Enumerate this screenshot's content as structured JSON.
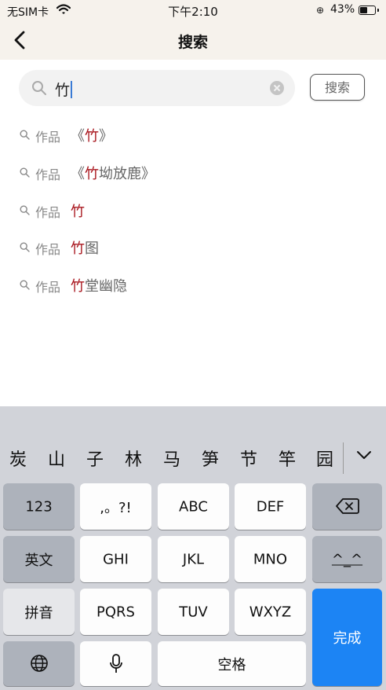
{
  "status_bar": {
    "carrier": "无SIM卡",
    "time": "下午2:10",
    "battery_percent": "43%",
    "battery_level": 0.43
  },
  "nav": {
    "title": "搜索"
  },
  "search": {
    "query": "竹",
    "button_label": "搜索"
  },
  "results": [
    {
      "category": "作品",
      "prefix": "《",
      "highlight": "竹",
      "suffix": "》"
    },
    {
      "category": "作品",
      "prefix": "《",
      "highlight": "竹",
      "suffix": "坳放鹿》"
    },
    {
      "category": "作品",
      "prefix": "",
      "highlight": "竹",
      "suffix": ""
    },
    {
      "category": "作品",
      "prefix": "",
      "highlight": "竹",
      "suffix": "图"
    },
    {
      "category": "作品",
      "prefix": "",
      "highlight": "竹",
      "suffix": "堂幽隐"
    }
  ],
  "keyboard": {
    "candidates": [
      "炭",
      "山",
      "子",
      "林",
      "马",
      "笋",
      "节",
      "竿",
      "园"
    ],
    "keys": {
      "num": "123",
      "punct": ",。?!",
      "abc": "ABC",
      "def": "DEF",
      "lang": "英文",
      "ghi": "GHI",
      "jkl": "JKL",
      "mno": "MNO",
      "emoticon": "^_^",
      "pinyin": "拼音",
      "pqrs": "PQRS",
      "tuv": "TUV",
      "wxyz": "WXYZ",
      "done": "完成",
      "space": "空格"
    }
  },
  "colors": {
    "highlight": "#a8141c",
    "done_key": "#1c84f4",
    "header_bg": "#f6f2ec"
  },
  "icons": [
    "wifi-icon",
    "lock-rotation-icon",
    "battery-icon",
    "back-chevron-icon",
    "search-icon",
    "clear-icon",
    "chevron-down-icon",
    "backspace-icon",
    "globe-icon",
    "microphone-icon"
  ]
}
